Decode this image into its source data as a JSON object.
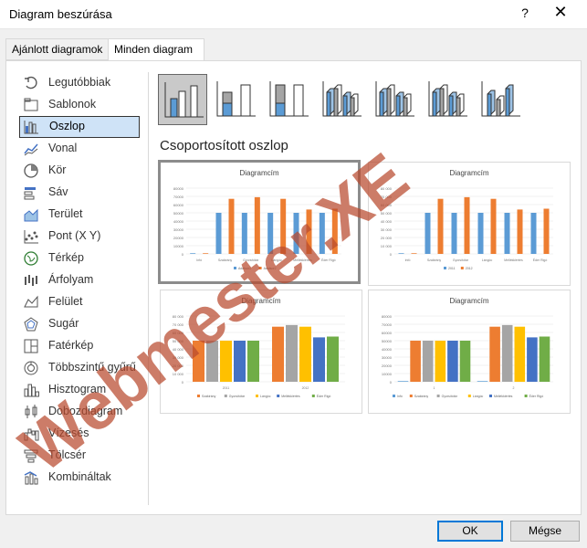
{
  "window": {
    "title": "Diagram beszúrása",
    "help_glyph": "?",
    "close_glyph": "✕"
  },
  "tabs": [
    {
      "label": "Ajánlott diagramok",
      "selected": false
    },
    {
      "label": "Minden diagram",
      "selected": true
    }
  ],
  "sidebar": {
    "items": [
      {
        "label": "Legutóbbiak",
        "icon": "recent-icon"
      },
      {
        "label": "Sablonok",
        "icon": "folder-icon"
      },
      {
        "label": "Oszlop",
        "icon": "column-chart-icon",
        "selected": true
      },
      {
        "label": "Vonal",
        "icon": "line-chart-icon"
      },
      {
        "label": "Kör",
        "icon": "pie-chart-icon"
      },
      {
        "label": "Sáv",
        "icon": "bar-chart-icon"
      },
      {
        "label": "Terület",
        "icon": "area-chart-icon"
      },
      {
        "label": "Pont (X Y)",
        "icon": "scatter-chart-icon"
      },
      {
        "label": "Térkép",
        "icon": "map-chart-icon"
      },
      {
        "label": "Árfolyam",
        "icon": "stock-chart-icon"
      },
      {
        "label": "Felület",
        "icon": "surface-chart-icon"
      },
      {
        "label": "Sugár",
        "icon": "radar-chart-icon"
      },
      {
        "label": "Fatérkép",
        "icon": "treemap-icon"
      },
      {
        "label": "Többszintű gyűrű",
        "icon": "sunburst-icon"
      },
      {
        "label": "Hisztogram",
        "icon": "histogram-icon"
      },
      {
        "label": "Dobozdiagram",
        "icon": "box-whisker-icon"
      },
      {
        "label": "Vízesés",
        "icon": "waterfall-icon"
      },
      {
        "label": "Tölcsér",
        "icon": "funnel-icon"
      },
      {
        "label": "Kombináltak",
        "icon": "combo-chart-icon"
      }
    ]
  },
  "subtypes": [
    {
      "name": "clustered-column",
      "selected": true
    },
    {
      "name": "stacked-column"
    },
    {
      "name": "100-stacked-column"
    },
    {
      "name": "3d-clustered-column"
    },
    {
      "name": "3d-stacked-column"
    },
    {
      "name": "3d-100-stacked-column"
    },
    {
      "name": "3d-column"
    }
  ],
  "selected_subtype_title": "Csoportosított oszlop",
  "previews": {
    "title": "Diagramcím",
    "colors": [
      "#5b9bd5",
      "#ed7d31",
      "#a5a5a5",
      "#ffc000",
      "#4472c4",
      "#70ad47"
    ]
  },
  "chart_data": [
    {
      "type": "bar",
      "title": "Diagramcím",
      "categories": [
        "Infó",
        "Szakirány",
        "Gyorsítótár",
        "Lángóc",
        "Mellékkiértés",
        "Éder Rigó"
      ],
      "series": [
        {
          "name": "Adatsor1",
          "values": [
            800,
            50000,
            50000,
            50000,
            50000,
            50000
          ]
        },
        {
          "name": "Adatsor2",
          "values": [
            800,
            67000,
            69000,
            67000,
            54000,
            55000
          ]
        }
      ],
      "yticks": [
        "80000",
        "70000",
        "60000",
        "50000",
        "40000",
        "30000",
        "20000",
        "10000",
        "0"
      ],
      "ylim": [
        0,
        80000
      ]
    },
    {
      "type": "bar",
      "title": "Diagramcím",
      "categories": [
        "Infó",
        "Szakirány",
        "Gyorsítótár",
        "Lángóc",
        "Mellékkiértés",
        "Éder Rigó"
      ],
      "series": [
        {
          "name": "2011",
          "values": [
            800,
            50000,
            50000,
            50000,
            50000,
            50000
          ]
        },
        {
          "name": "2012",
          "values": [
            800,
            67000,
            69000,
            67000,
            54000,
            55000
          ]
        }
      ],
      "yticks": [
        "80 000",
        "70 000",
        "60 000",
        "50 000",
        "40 000",
        "30 000",
        "20 000",
        "10 000",
        "0"
      ],
      "ylim": [
        0,
        80000
      ]
    },
    {
      "type": "bar",
      "title": "Diagramcím",
      "categories": [
        "2011",
        "2012"
      ],
      "series": [
        {
          "name": "Szakirány",
          "values": [
            50000,
            67000
          ]
        },
        {
          "name": "Gyorsítótár",
          "values": [
            50000,
            69000
          ]
        },
        {
          "name": "Lángóc",
          "values": [
            50000,
            67000
          ]
        },
        {
          "name": "Mellékkiértés",
          "values": [
            50000,
            54000
          ]
        },
        {
          "name": "Éder Rigó",
          "values": [
            50000,
            55000
          ]
        }
      ],
      "yticks": [
        "80 000",
        "70 000",
        "60 000",
        "50 000",
        "40 000",
        "30 000",
        "20 000",
        "10 000",
        "0"
      ],
      "ylim": [
        0,
        80000
      ]
    },
    {
      "type": "bar",
      "title": "Diagramcím",
      "categories": [
        "1",
        "2"
      ],
      "series": [
        {
          "name": "Infó",
          "values": [
            800,
            800
          ]
        },
        {
          "name": "Szakirány",
          "values": [
            50000,
            67000
          ]
        },
        {
          "name": "Gyorsítótár",
          "values": [
            50000,
            69000
          ]
        },
        {
          "name": "Lángóc",
          "values": [
            50000,
            67000
          ]
        },
        {
          "name": "Mellékkiértés",
          "values": [
            50000,
            54000
          ]
        },
        {
          "name": "Éder Rigó",
          "values": [
            50000,
            55000
          ]
        }
      ],
      "yticks": [
        "80000",
        "70000",
        "60000",
        "50000",
        "40000",
        "30000",
        "20000",
        "10000",
        "0"
      ],
      "ylim": [
        0,
        80000
      ]
    }
  ],
  "buttons": {
    "ok": "OK",
    "cancel": "Mégse"
  },
  "watermark": {
    "text": "Webmester.XE",
    "color": "#b84a2e"
  }
}
